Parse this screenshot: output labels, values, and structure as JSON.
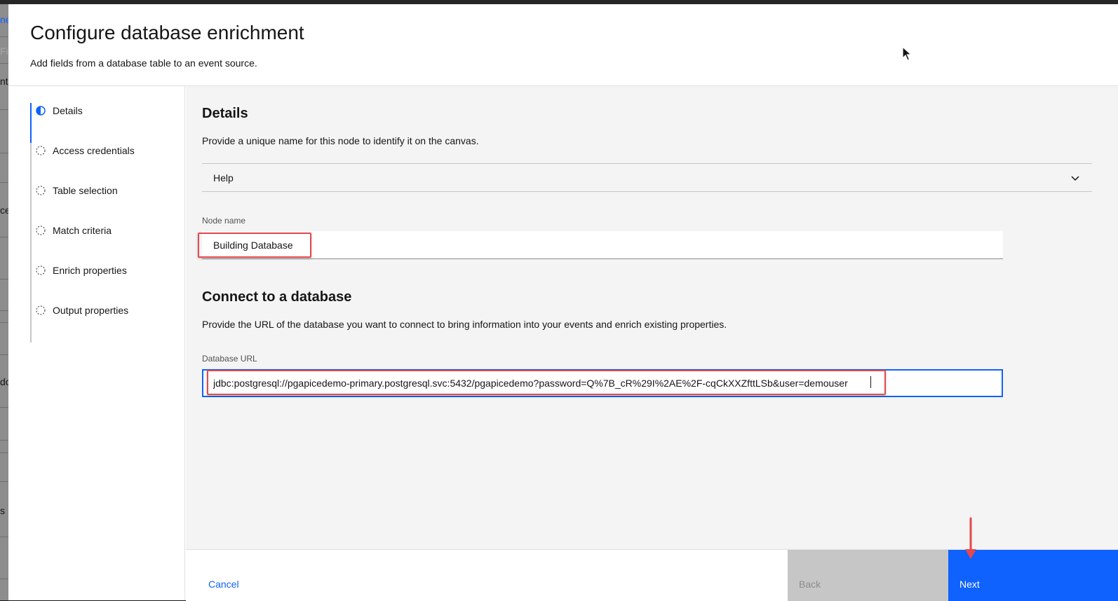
{
  "background": {
    "fragments": [
      "ne",
      "Fi",
      "nts",
      "ce",
      "do",
      "s"
    ]
  },
  "modal": {
    "title": "Configure database enrichment",
    "subtitle": "Add fields from a database table to an event source."
  },
  "steps": [
    {
      "label": "Details",
      "state": "current"
    },
    {
      "label": "Access credentials",
      "state": "incomplete"
    },
    {
      "label": "Table selection",
      "state": "incomplete"
    },
    {
      "label": "Match criteria",
      "state": "incomplete"
    },
    {
      "label": "Enrich properties",
      "state": "incomplete"
    },
    {
      "label": "Output properties",
      "state": "incomplete"
    }
  ],
  "details": {
    "title": "Details",
    "description": "Provide a unique name for this node to identify it on the canvas.",
    "help_label": "Help",
    "node_name_label": "Node name",
    "node_name_value": "Building Database"
  },
  "connect": {
    "title": "Connect to a database",
    "description": "Provide the URL of the database you want to connect to bring information into your events and enrich existing properties.",
    "url_label": "Database URL",
    "url_value": "jdbc:postgresql://pgapicedemo-primary.postgresql.svc:5432/pgapicedemo?password=Q%7B_cR%29I%2AE%2F-cqCkXXZfttLSb&user=demouser"
  },
  "footer": {
    "cancel_label": "Cancel",
    "back_label": "Back",
    "next_label": "Next"
  },
  "colors": {
    "primary": "#0f62fe",
    "annotation": "#e5484d",
    "disabled": "#c6c6c6"
  },
  "icons": {
    "current_step": "half-filled-circle-icon",
    "incomplete_step": "dashed-circle-icon",
    "accordion": "chevron-down-icon"
  }
}
